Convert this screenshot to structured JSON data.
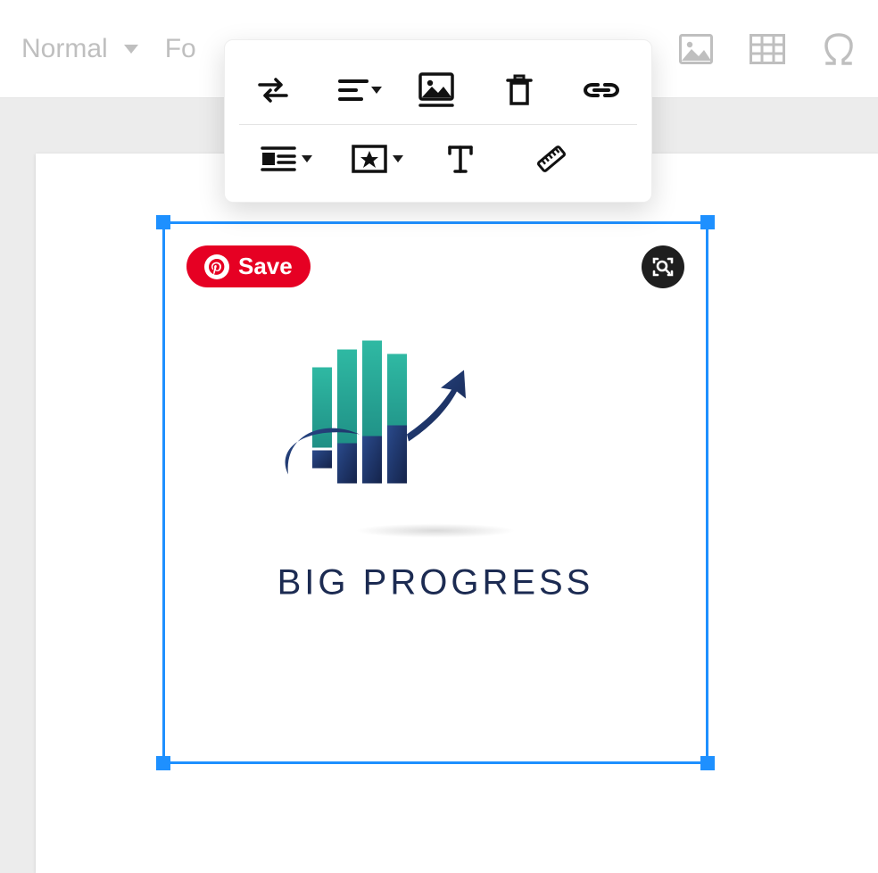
{
  "top_toolbar": {
    "style_select": "Normal",
    "font_select_prefix": "Fo"
  },
  "save_button": {
    "label": "Save"
  },
  "logo": {
    "text": "BIG PROGRESS"
  },
  "float_toolbar": {
    "row1": {
      "replace": "replace-image",
      "align": "align",
      "display": "image-display",
      "delete": "delete",
      "link": "link"
    },
    "row2": {
      "wrap": "text-wrap",
      "style": "image-style",
      "caption": "caption",
      "size": "resize"
    }
  }
}
